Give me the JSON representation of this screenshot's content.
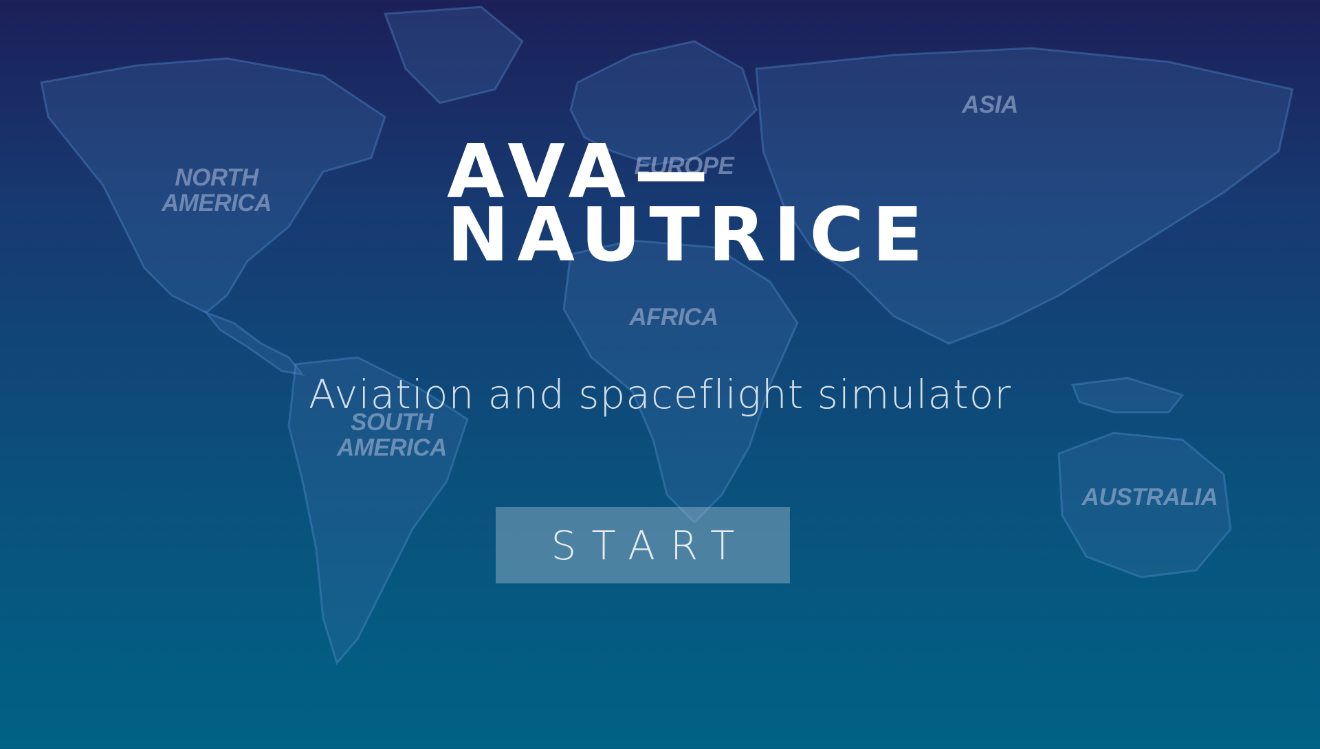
{
  "app": {
    "title_line1": "AVA—",
    "title_line2": "NAUTRICE",
    "subtitle": "Aviation and spaceflight simulator",
    "start_label": "START"
  },
  "map": {
    "labels": {
      "north_america": "NORTH\nAMERICA",
      "europe": "EUROPE",
      "asia": "ASIA",
      "africa": "AFRICA",
      "south_america": "SOUTH\nAMERICA",
      "australia": "AUSTRALIA"
    }
  },
  "colors": {
    "background_top": "#1c1f58",
    "background_bottom": "#006285",
    "title": "#ffffff",
    "button_fill": "#a0b9cd"
  }
}
